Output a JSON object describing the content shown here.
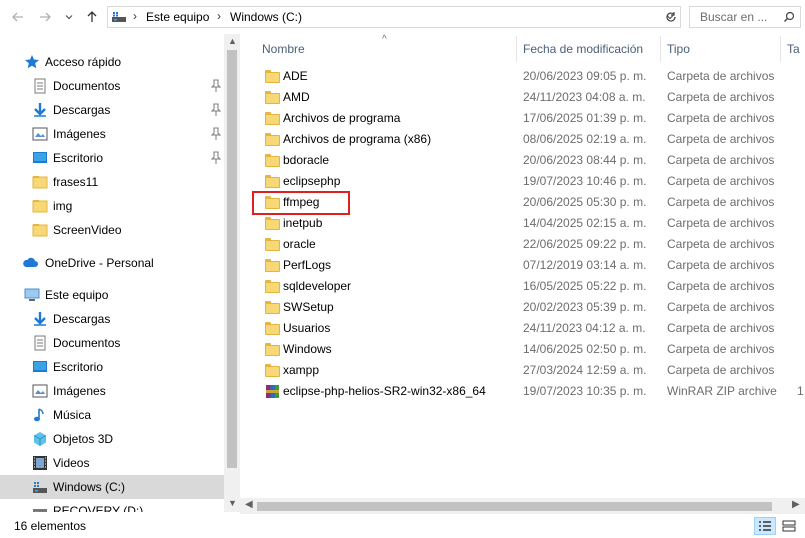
{
  "address": {
    "crumbs": [
      "Este equipo",
      "Windows (C:)"
    ],
    "search_placeholder": "Buscar en ..."
  },
  "nav": {
    "quick_access": "Acceso rápido",
    "quick_items": [
      {
        "label": "Documentos",
        "icon": "documents-icon",
        "pinned": true
      },
      {
        "label": "Descargas",
        "icon": "downloads-icon",
        "pinned": true
      },
      {
        "label": "Imágenes",
        "icon": "pictures-icon",
        "pinned": true
      },
      {
        "label": "Escritorio",
        "icon": "desktop-icon",
        "pinned": true
      },
      {
        "label": "frases11",
        "icon": "folder-icon",
        "pinned": false
      },
      {
        "label": "img",
        "icon": "folder-icon",
        "pinned": false
      },
      {
        "label": "ScreenVideo",
        "icon": "folder-icon",
        "pinned": false
      }
    ],
    "onedrive": "OneDrive - Personal",
    "this_pc": "Este equipo",
    "pc_items": [
      {
        "label": "Descargas",
        "icon": "downloads-icon"
      },
      {
        "label": "Documentos",
        "icon": "documents-icon"
      },
      {
        "label": "Escritorio",
        "icon": "desktop-icon"
      },
      {
        "label": "Imágenes",
        "icon": "pictures-icon"
      },
      {
        "label": "Música",
        "icon": "music-icon"
      },
      {
        "label": "Objetos 3D",
        "icon": "3d-objects-icon"
      },
      {
        "label": "Videos",
        "icon": "videos-icon"
      },
      {
        "label": "Windows (C:)",
        "icon": "drive-icon"
      },
      {
        "label": "RECOVERY (D:)",
        "icon": "drive-icon"
      }
    ]
  },
  "columns": {
    "name": "Nombre",
    "date": "Fecha de modificación",
    "type": "Tipo",
    "size": "Ta"
  },
  "files": [
    {
      "name": "ADE",
      "date": "20/06/2023 09:05 p. m.",
      "type": "Carpeta de archivos",
      "size": ""
    },
    {
      "name": "AMD",
      "date": "24/11/2023 04:08 a. m.",
      "type": "Carpeta de archivos",
      "size": ""
    },
    {
      "name": "Archivos de programa",
      "date": "17/06/2025 01:39 p. m.",
      "type": "Carpeta de archivos",
      "size": ""
    },
    {
      "name": "Archivos de programa (x86)",
      "date": "08/06/2025 02:19 a. m.",
      "type": "Carpeta de archivos",
      "size": ""
    },
    {
      "name": "bdoracle",
      "date": "20/06/2023 08:44 p. m.",
      "type": "Carpeta de archivos",
      "size": ""
    },
    {
      "name": "eclipsephp",
      "date": "19/07/2023 10:46 p. m.",
      "type": "Carpeta de archivos",
      "size": ""
    },
    {
      "name": "ffmpeg",
      "date": "20/06/2025 05:30 p. m.",
      "type": "Carpeta de archivos",
      "size": ""
    },
    {
      "name": "inetpub",
      "date": "14/04/2025 02:15 a. m.",
      "type": "Carpeta de archivos",
      "size": ""
    },
    {
      "name": "oracle",
      "date": "22/06/2025 09:22 p. m.",
      "type": "Carpeta de archivos",
      "size": ""
    },
    {
      "name": "PerfLogs",
      "date": "07/12/2019 03:14 a. m.",
      "type": "Carpeta de archivos",
      "size": ""
    },
    {
      "name": "sqldeveloper",
      "date": "16/05/2025 05:22 p. m.",
      "type": "Carpeta de archivos",
      "size": ""
    },
    {
      "name": "SWSetup",
      "date": "20/02/2023 05:39 p. m.",
      "type": "Carpeta de archivos",
      "size": ""
    },
    {
      "name": "Usuarios",
      "date": "24/11/2023 04:12 a. m.",
      "type": "Carpeta de archivos",
      "size": ""
    },
    {
      "name": "Windows",
      "date": "14/06/2025 02:50 p. m.",
      "type": "Carpeta de archivos",
      "size": ""
    },
    {
      "name": "xampp",
      "date": "27/03/2024 12:59 a. m.",
      "type": "Carpeta de archivos",
      "size": ""
    },
    {
      "name": "eclipse-php-helios-SR2-win32-x86_64",
      "date": "19/07/2023 10:35 p. m.",
      "type": "WinRAR ZIP archive",
      "size": "1"
    }
  ],
  "status": {
    "count": "16 elementos"
  },
  "colors": {
    "selected_bg": "#cce8ff",
    "highlight_border": "#e02020",
    "folder_yellow": "#f8d775"
  }
}
